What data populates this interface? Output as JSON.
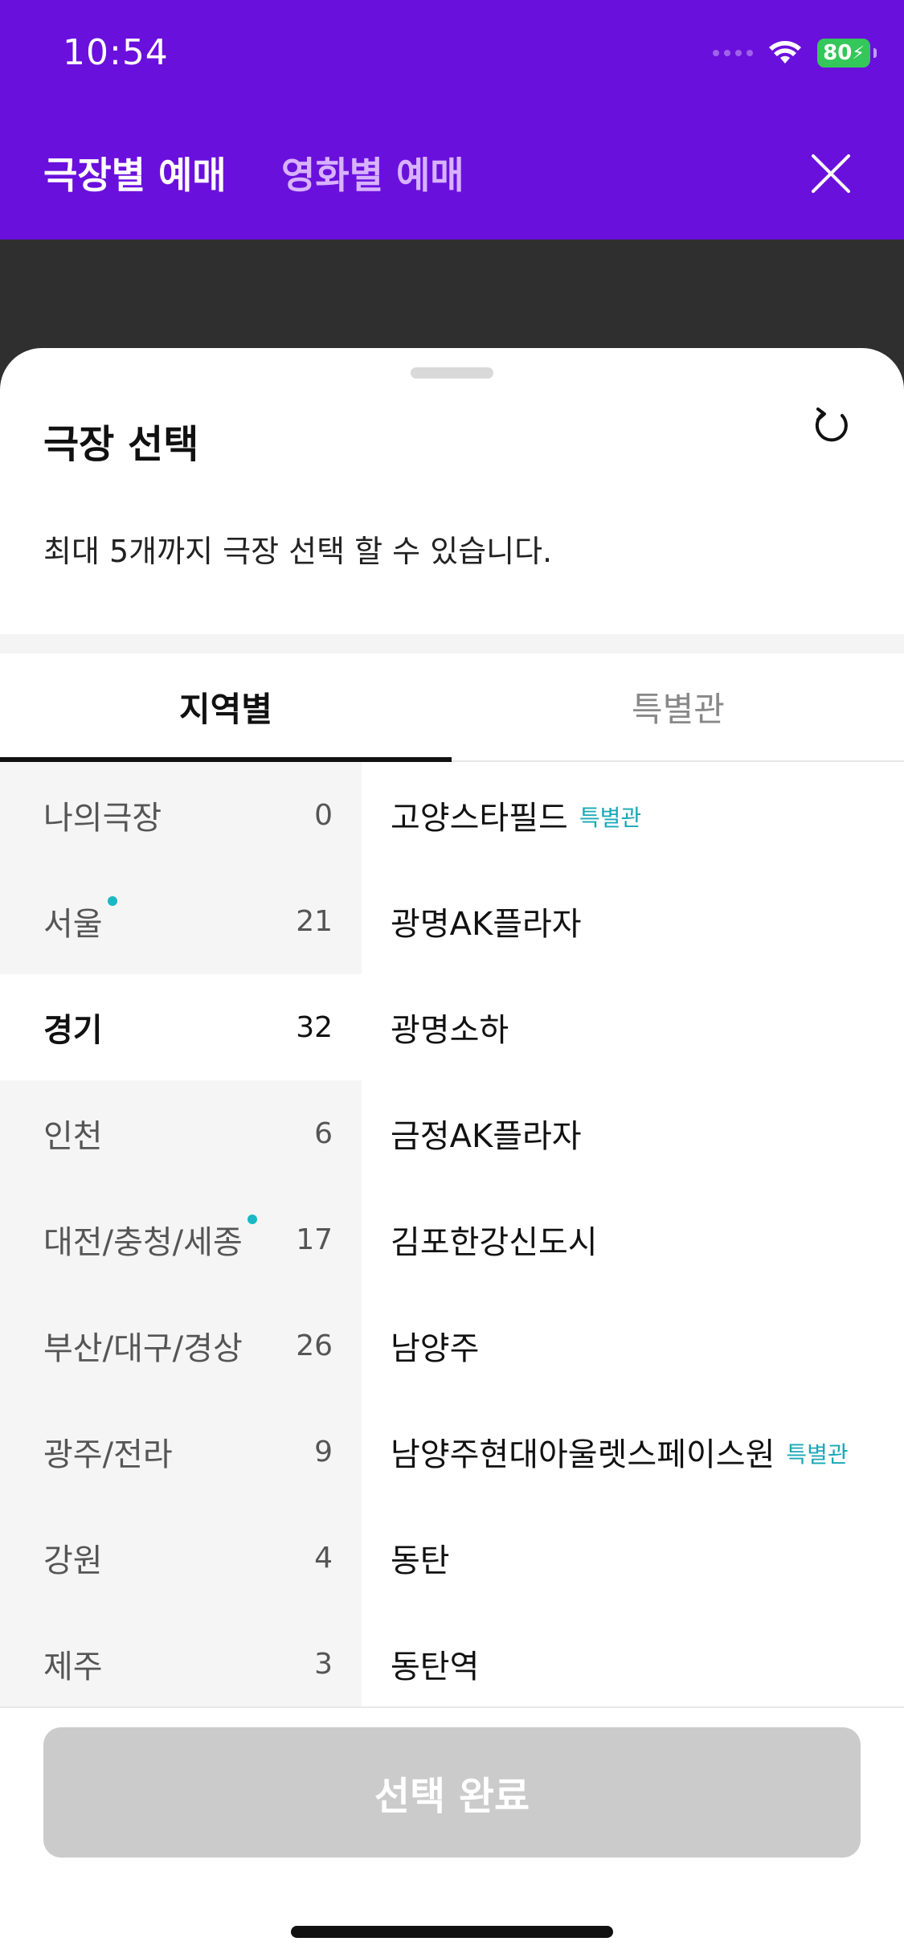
{
  "status_bar": {
    "time": "10:54",
    "battery": "80"
  },
  "header": {
    "tabs": [
      {
        "label": "극장별 예매"
      },
      {
        "label": "영화별 예매"
      }
    ]
  },
  "sheet": {
    "title": "극장 선택",
    "notice": "최대 5개까지 극장 선택 할 수 있습니다.",
    "tabs": [
      {
        "label": "지역별"
      },
      {
        "label": "특별관"
      }
    ],
    "regions": [
      {
        "name": "나의극장",
        "count": "0"
      },
      {
        "name": "서울",
        "count": "21"
      },
      {
        "name": "경기",
        "count": "32"
      },
      {
        "name": "인천",
        "count": "6"
      },
      {
        "name": "대전/충청/세종",
        "count": "17"
      },
      {
        "name": "부산/대구/경상",
        "count": "26"
      },
      {
        "name": "광주/전라",
        "count": "9"
      },
      {
        "name": "강원",
        "count": "4"
      },
      {
        "name": "제주",
        "count": "3"
      }
    ],
    "theaters": [
      {
        "name": "고양스타필드",
        "tag": "특별관"
      },
      {
        "name": "광명AK플라자"
      },
      {
        "name": "광명소하"
      },
      {
        "name": "금정AK플라자"
      },
      {
        "name": "김포한강신도시"
      },
      {
        "name": "남양주"
      },
      {
        "name": "남양주현대아울렛스페이스원",
        "tag": "특별관"
      },
      {
        "name": "동탄"
      },
      {
        "name": "동탄역"
      }
    ],
    "confirm_label": "선택 완료"
  },
  "colors": {
    "brand": "#6a10dc",
    "accent_teal": "#1aa8b7",
    "disabled_button": "#cbcbcb"
  }
}
